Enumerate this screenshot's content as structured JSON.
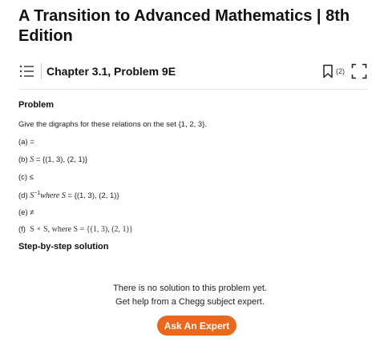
{
  "book": {
    "title": "A Transition to Advanced Mathematics | 8th Edition"
  },
  "chapter_bar": {
    "chapter_label": "Chapter 3.1, Problem 9E",
    "bookmark_count": "(2)"
  },
  "problem": {
    "heading": "Problem",
    "intro": "Give the digraphs for these relations on the set {1, 2, 3}.",
    "parts": {
      "a": {
        "label": "(a)",
        "symbol": "="
      },
      "b": {
        "label": "(b)",
        "var": "S",
        "rest": " = {(1, 3), (2, 1)}"
      },
      "c": {
        "label": "(c)",
        "symbol": "≤"
      },
      "d": {
        "label": "(d)",
        "var": "S",
        "sup": "−1",
        "where": "where ",
        "var2": "S",
        "rest": " = {(1, 3), (2, 1)}"
      },
      "e": {
        "label": "(e)",
        "symbol": "≠"
      },
      "f": {
        "label": "(f)",
        "expr": "S ∘ S, where S = {(1, 3), (2, 1)}"
      }
    }
  },
  "solution": {
    "heading": "Step-by-step solution",
    "no_solution_line1": "There is no solution to this problem yet.",
    "no_solution_line2": "Get help from a Chegg subject expert.",
    "ask_button": "Ask An Expert"
  },
  "colors": {
    "accent": "#e8681e",
    "text": "#1a1a1a"
  },
  "icons": {
    "toc": "list-icon",
    "bookmark": "bookmark-icon",
    "expand": "expand-icon"
  }
}
